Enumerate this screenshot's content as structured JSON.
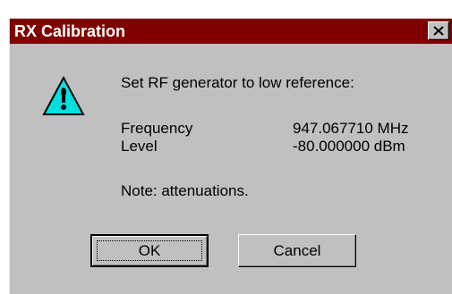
{
  "window": {
    "title": "RX Calibration",
    "close_icon": "close-x-icon"
  },
  "message": {
    "icon": "warning-icon",
    "prompt": "Set RF generator to low reference:",
    "frequency_label": "Frequency",
    "frequency_value": "947.067710 MHz",
    "level_label": "Level",
    "level_value": "-80.000000 dBm",
    "note": "Note: attenuations."
  },
  "buttons": {
    "ok_label": "OK",
    "cancel_label": "Cancel"
  },
  "colors": {
    "titlebar": "#800000",
    "dialog_face": "#c0c0c0",
    "warning_fill": "#00e0e0"
  }
}
